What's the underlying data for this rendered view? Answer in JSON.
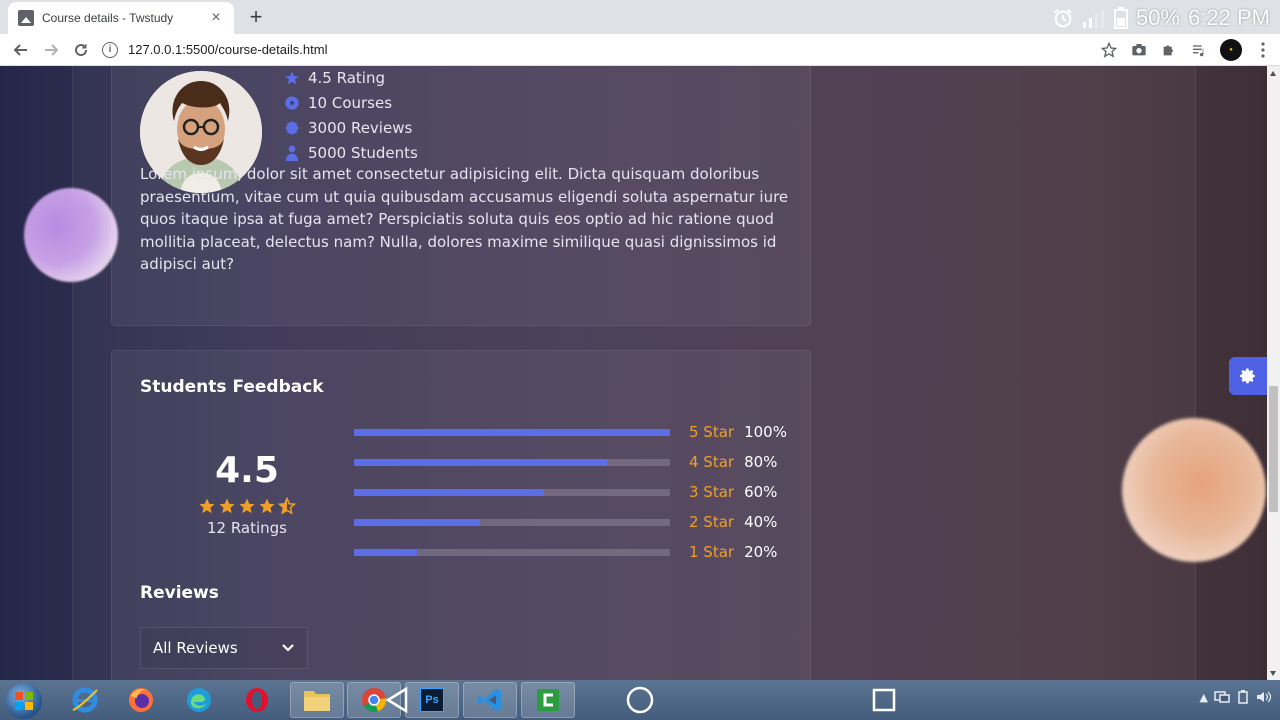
{
  "browser": {
    "tab_title": "Course details - Twstudy",
    "tab_close": "×",
    "new_tab": "+",
    "url": "127.0.0.1:5500/course-details.html",
    "info_glyph": "i"
  },
  "status_bar": {
    "battery_percent": "50%",
    "clock": "6:22 PM"
  },
  "instructor": {
    "stats": [
      {
        "icon": "star-icon",
        "label": "4.5 Rating"
      },
      {
        "icon": "play-circle-icon",
        "label": "10 Courses"
      },
      {
        "icon": "badge-icon",
        "label": "3000 Reviews"
      },
      {
        "icon": "user-icon",
        "label": "5000 Students"
      }
    ],
    "bio": "Lorem ipsum, dolor sit amet consectetur adipisicing elit. Dicta quisquam doloribus praesentium, vitae cum ut quia quibusdam accusamus eligendi soluta aspernatur iure quos itaque ipsa at fuga amet? Perspiciatis soluta quis eos optio ad hic ratione quod mollitia placeat, delectus nam? Nulla, dolores maxime similique quasi dignissimos id adipisci aut?"
  },
  "feedback": {
    "title": "Students Feedback",
    "average": "4.5",
    "star_rating": 4.5,
    "ratings_count": "12 Ratings",
    "breakdown": [
      {
        "label": "5 Star",
        "percent_text": "100%",
        "value": 100
      },
      {
        "label": "4 Star",
        "percent_text": "80%",
        "value": 80
      },
      {
        "label": "3 Star",
        "percent_text": "60%",
        "value": 60
      },
      {
        "label": "2 Star",
        "percent_text": "40%",
        "value": 40
      },
      {
        "label": "1 Star",
        "percent_text": "20%",
        "value": 20
      }
    ],
    "reviews_title": "Reviews",
    "reviews_filter": "All Reviews"
  },
  "colors": {
    "accent": "#5b6ee8",
    "star": "#ee9f2a",
    "settings_button": "#4f62e6"
  },
  "taskbar": {
    "icons": [
      "windows-start-icon",
      "internet-explorer-icon",
      "firefox-icon",
      "edge-icon",
      "opera-icon",
      "file-explorer-icon",
      "chrome-icon",
      "photoshop-icon",
      "vscode-icon",
      "camtasia-icon"
    ],
    "photoshop_label": "Ps"
  }
}
